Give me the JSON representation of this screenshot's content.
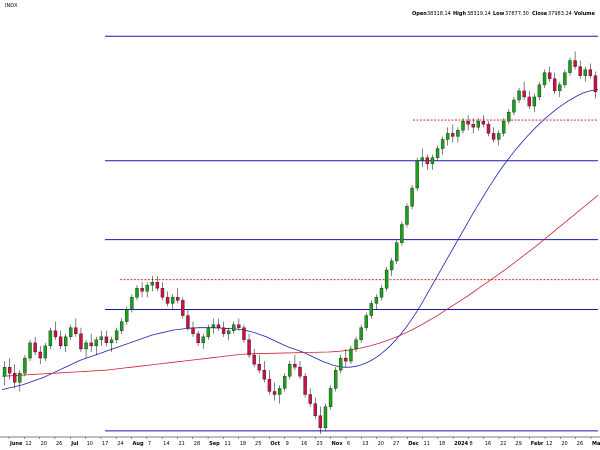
{
  "header": {
    "symbol": "INDX",
    "open_label": "Open",
    "open_value": "38318.14",
    "high_label": "High",
    "high_value": "38319.14",
    "low_label": "Low",
    "low_value": "37877.30",
    "close_label": "Close",
    "close_value": "37983.24",
    "volume_label": "Volume"
  },
  "chart_data": {
    "type": "candlestick",
    "title": "",
    "xlabel": "",
    "ylabel": "",
    "x_axis_labels": [
      {
        "text": "June",
        "bold": true
      },
      {
        "text": "12",
        "bold": false
      },
      {
        "text": "20",
        "bold": false
      },
      {
        "text": "26",
        "bold": false
      },
      {
        "text": "Jul",
        "bold": true
      },
      {
        "text": "10",
        "bold": false
      },
      {
        "text": "17",
        "bold": false
      },
      {
        "text": "24",
        "bold": false
      },
      {
        "text": "Aug",
        "bold": true
      },
      {
        "text": "7",
        "bold": false
      },
      {
        "text": "14",
        "bold": false
      },
      {
        "text": "21",
        "bold": false
      },
      {
        "text": "28",
        "bold": false
      },
      {
        "text": "Sep",
        "bold": true
      },
      {
        "text": "11",
        "bold": false
      },
      {
        "text": "18",
        "bold": false
      },
      {
        "text": "25",
        "bold": false
      },
      {
        "text": "Oct",
        "bold": true
      },
      {
        "text": "9",
        "bold": false
      },
      {
        "text": "16",
        "bold": false
      },
      {
        "text": "23",
        "bold": false
      },
      {
        "text": "Nov",
        "bold": true
      },
      {
        "text": "6",
        "bold": false
      },
      {
        "text": "13",
        "bold": false
      },
      {
        "text": "20",
        "bold": false
      },
      {
        "text": "27",
        "bold": false
      },
      {
        "text": "Dec",
        "bold": true
      },
      {
        "text": "11",
        "bold": false
      },
      {
        "text": "18",
        "bold": false
      },
      {
        "text": "2024",
        "bold": true
      },
      {
        "text": "8",
        "bold": false
      },
      {
        "text": "16",
        "bold": false
      },
      {
        "text": "22",
        "bold": false
      },
      {
        "text": "29",
        "bold": false
      },
      {
        "text": "Febr",
        "bold": true
      },
      {
        "text": "12",
        "bold": false
      },
      {
        "text": "20",
        "bold": false
      },
      {
        "text": "26",
        "bold": false
      },
      {
        "text": "Mar",
        "bold": true
      }
    ],
    "y_range": [
      32300,
      39200
    ],
    "horizontal_levels": [
      {
        "value": 38900,
        "style": "solid",
        "color": "#1a1aaa"
      },
      {
        "value": 36850,
        "style": "solid",
        "color": "#1a1aaa"
      },
      {
        "value": 35550,
        "style": "solid",
        "color": "#1a1aaa"
      },
      {
        "value": 34400,
        "style": "solid",
        "color": "#1a1aaa"
      },
      {
        "value": 32400,
        "style": "solid",
        "color": "#1a1aaa"
      },
      {
        "value": 37520,
        "style": "dashed",
        "color": "#cc1111"
      },
      {
        "value": 34890,
        "style": "dashed",
        "color": "#cc1111"
      }
    ],
    "candle_colors": {
      "up": "#1aa01a",
      "down": "#cc1144"
    },
    "series": [
      {
        "kind": "candles",
        "ohlc": [
          [
            33300,
            33550,
            33150,
            33450
          ],
          [
            33450,
            33600,
            33250,
            33350
          ],
          [
            33350,
            33500,
            33100,
            33200
          ],
          [
            33200,
            33400,
            33050,
            33350
          ],
          [
            33350,
            33650,
            33300,
            33600
          ],
          [
            33600,
            33900,
            33550,
            33850
          ],
          [
            33850,
            33950,
            33650,
            33700
          ],
          [
            33700,
            33800,
            33500,
            33600
          ],
          [
            33600,
            33850,
            33550,
            33800
          ],
          [
            33800,
            34100,
            33750,
            34050
          ],
          [
            34050,
            34200,
            33900,
            33950
          ],
          [
            33950,
            34050,
            33750,
            33800
          ],
          [
            33800,
            34000,
            33700,
            33950
          ],
          [
            33950,
            34150,
            33900,
            34100
          ],
          [
            34100,
            34250,
            33950,
            34000
          ],
          [
            34000,
            34100,
            33700,
            33750
          ],
          [
            33750,
            33900,
            33600,
            33850
          ],
          [
            33850,
            34000,
            33700,
            33800
          ],
          [
            33800,
            33950,
            33650,
            33900
          ],
          [
            33900,
            34050,
            33800,
            33950
          ],
          [
            33950,
            34050,
            33800,
            33850
          ],
          [
            33850,
            33950,
            33700,
            33900
          ],
          [
            33900,
            34100,
            33850,
            34050
          ],
          [
            34050,
            34250,
            34000,
            34200
          ],
          [
            34200,
            34450,
            34150,
            34400
          ],
          [
            34400,
            34650,
            34350,
            34600
          ],
          [
            34600,
            34800,
            34550,
            34750
          ],
          [
            34750,
            34850,
            34600,
            34700
          ],
          [
            34700,
            34850,
            34600,
            34800
          ],
          [
            34800,
            34950,
            34700,
            34850
          ],
          [
            34850,
            34950,
            34700,
            34750
          ],
          [
            34750,
            34850,
            34550,
            34600
          ],
          [
            34600,
            34700,
            34450,
            34500
          ],
          [
            34500,
            34650,
            34400,
            34600
          ],
          [
            34600,
            34750,
            34500,
            34550
          ],
          [
            34550,
            34600,
            34250,
            34300
          ],
          [
            34300,
            34400,
            34050,
            34100
          ],
          [
            34100,
            34200,
            33950,
            34000
          ],
          [
            34000,
            34050,
            33800,
            33850
          ],
          [
            33850,
            34000,
            33750,
            33950
          ],
          [
            33950,
            34150,
            33900,
            34100
          ],
          [
            34100,
            34250,
            34000,
            34150
          ],
          [
            34150,
            34250,
            34050,
            34100
          ],
          [
            34100,
            34200,
            33950,
            34000
          ],
          [
            34000,
            34100,
            33900,
            34050
          ],
          [
            34050,
            34200,
            34000,
            34150
          ],
          [
            34150,
            34250,
            34050,
            34100
          ],
          [
            34100,
            34150,
            33850,
            33900
          ],
          [
            33900,
            34000,
            33600,
            33650
          ],
          [
            33650,
            33750,
            33450,
            33500
          ],
          [
            33500,
            33650,
            33350,
            33400
          ],
          [
            33400,
            33550,
            33200,
            33250
          ],
          [
            33250,
            33400,
            33000,
            33050
          ],
          [
            33050,
            33200,
            32900,
            33000
          ],
          [
            33000,
            33150,
            32850,
            33100
          ],
          [
            33100,
            33350,
            33050,
            33300
          ],
          [
            33300,
            33550,
            33250,
            33500
          ],
          [
            33500,
            33650,
            33400,
            33450
          ],
          [
            33450,
            33550,
            33250,
            33300
          ],
          [
            33300,
            33350,
            32950,
            33000
          ],
          [
            33000,
            33100,
            32800,
            32850
          ],
          [
            32850,
            32950,
            32600,
            32650
          ],
          [
            32650,
            32800,
            32350,
            32450
          ],
          [
            32450,
            32850,
            32400,
            32800
          ],
          [
            32800,
            33150,
            32750,
            33100
          ],
          [
            33100,
            33450,
            33050,
            33400
          ],
          [
            33400,
            33650,
            33350,
            33600
          ],
          [
            33600,
            33750,
            33450,
            33550
          ],
          [
            33550,
            33800,
            33500,
            33750
          ],
          [
            33750,
            33950,
            33700,
            33900
          ],
          [
            33900,
            34150,
            33850,
            34100
          ],
          [
            34100,
            34350,
            34050,
            34300
          ],
          [
            34300,
            34550,
            34250,
            34500
          ],
          [
            34500,
            34650,
            34400,
            34600
          ],
          [
            34600,
            34800,
            34550,
            34750
          ],
          [
            34750,
            35100,
            34700,
            35050
          ],
          [
            35050,
            35250,
            34950,
            35200
          ],
          [
            35200,
            35550,
            35150,
            35500
          ],
          [
            35500,
            35850,
            35450,
            35800
          ],
          [
            35800,
            36150,
            35750,
            36100
          ],
          [
            36100,
            36450,
            36050,
            36400
          ],
          [
            36400,
            36900,
            36350,
            36850
          ],
          [
            36850,
            37050,
            36750,
            36900
          ],
          [
            36900,
            36950,
            36700,
            36800
          ],
          [
            36800,
            36950,
            36700,
            36900
          ],
          [
            36900,
            37100,
            36850,
            37050
          ],
          [
            37050,
            37250,
            36950,
            37200
          ],
          [
            37200,
            37400,
            37100,
            37300
          ],
          [
            37300,
            37450,
            37150,
            37250
          ],
          [
            37250,
            37400,
            37150,
            37350
          ],
          [
            37350,
            37550,
            37300,
            37500
          ],
          [
            37500,
            37600,
            37350,
            37450
          ],
          [
            37450,
            37550,
            37300,
            37400
          ],
          [
            37400,
            37550,
            37350,
            37500
          ],
          [
            37500,
            37600,
            37400,
            37450
          ],
          [
            37450,
            37500,
            37250,
            37300
          ],
          [
            37300,
            37400,
            37150,
            37200
          ],
          [
            37200,
            37350,
            37100,
            37300
          ],
          [
            37300,
            37550,
            37250,
            37500
          ],
          [
            37500,
            37700,
            37450,
            37650
          ],
          [
            37650,
            37900,
            37600,
            37850
          ],
          [
            37850,
            38050,
            37800,
            38000
          ],
          [
            38000,
            38150,
            37850,
            37900
          ],
          [
            37900,
            38000,
            37700,
            37750
          ],
          [
            37750,
            37950,
            37650,
            37900
          ],
          [
            37900,
            38150,
            37850,
            38100
          ],
          [
            38100,
            38350,
            38050,
            38300
          ],
          [
            38300,
            38400,
            38150,
            38200
          ],
          [
            38200,
            38300,
            37950,
            38000
          ],
          [
            38000,
            38150,
            37900,
            38100
          ],
          [
            38100,
            38350,
            38050,
            38300
          ],
          [
            38300,
            38550,
            38250,
            38500
          ],
          [
            38500,
            38650,
            38350,
            38400
          ],
          [
            38400,
            38500,
            38200,
            38250
          ],
          [
            38250,
            38400,
            38150,
            38350
          ],
          [
            38350,
            38450,
            38200,
            38250
          ],
          [
            38250,
            38319,
            37877,
            37983
          ]
        ]
      },
      {
        "kind": "moving-average",
        "color": "#2020b0",
        "values": [
          33080,
          33100,
          33120,
          33140,
          33160,
          33190,
          33220,
          33250,
          33280,
          33320,
          33360,
          33400,
          33440,
          33480,
          33520,
          33560,
          33590,
          33620,
          33650,
          33680,
          33710,
          33740,
          33770,
          33800,
          33830,
          33860,
          33890,
          33920,
          33950,
          33980,
          34000,
          34020,
          34040,
          34060,
          34070,
          34080,
          34090,
          34095,
          34100,
          34100,
          34100,
          34098,
          34095,
          34090,
          34085,
          34080,
          34070,
          34055,
          34035,
          34010,
          33980,
          33950,
          33910,
          33870,
          33830,
          33790,
          33760,
          33730,
          33700,
          33660,
          33620,
          33580,
          33540,
          33510,
          33480,
          33460,
          33450,
          33450,
          33460,
          33480,
          33510,
          33550,
          33600,
          33660,
          33730,
          33810,
          33900,
          34000,
          34110,
          34230,
          34360,
          34500,
          34650,
          34800,
          34950,
          35100,
          35250,
          35400,
          35550,
          35700,
          35850,
          36000,
          36140,
          36280,
          36420,
          36550,
          36680,
          36800,
          36910,
          37020,
          37120,
          37220,
          37310,
          37400,
          37480,
          37560,
          37630,
          37700,
          37760,
          37820,
          37870,
          37920,
          37960,
          37990,
          38010,
          38020
        ]
      },
      {
        "kind": "moving-average",
        "color": "#cc2233",
        "values": [
          33300,
          33305,
          33310,
          33315,
          33320,
          33325,
          33330,
          33335,
          33340,
          33345,
          33350,
          33355,
          33360,
          33365,
          33370,
          33375,
          33380,
          33385,
          33390,
          33395,
          33400,
          33410,
          33420,
          33430,
          33440,
          33450,
          33460,
          33470,
          33480,
          33490,
          33500,
          33510,
          33520,
          33530,
          33540,
          33550,
          33560,
          33570,
          33580,
          33590,
          33600,
          33610,
          33620,
          33630,
          33640,
          33650,
          33660,
          33665,
          33670,
          33672,
          33674,
          33676,
          33678,
          33680,
          33682,
          33684,
          33686,
          33688,
          33690,
          33692,
          33694,
          33696,
          33698,
          33700,
          33705,
          33710,
          33720,
          33730,
          33745,
          33760,
          33780,
          33800,
          33825,
          33850,
          33880,
          33910,
          33945,
          33980,
          34020,
          34060,
          34105,
          34150,
          34200,
          34250,
          34300,
          34355,
          34410,
          34465,
          34520,
          34575,
          34630,
          34690,
          34750,
          34810,
          34870,
          34930,
          34990,
          35050,
          35115,
          35180,
          35245,
          35310,
          35375,
          35440,
          35510,
          35580,
          35650,
          35720,
          35790,
          35860,
          35930,
          36000,
          36070,
          36140,
          36210,
          36280
        ]
      }
    ]
  }
}
